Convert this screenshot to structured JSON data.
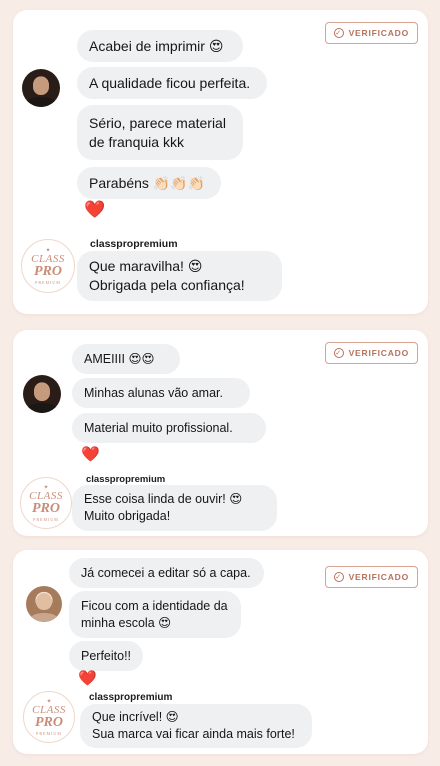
{
  "badge_label": "VERIFICADO",
  "cards": [
    {
      "customer_messages": [
        "Acabei de imprimir 😍",
        "A qualidade ficou perfeita.",
        [
          "Sério, parece material",
          "de franquia kkk"
        ],
        "Parabéns 👏🏻👏🏻👏🏻"
      ],
      "reaction": "❤️",
      "sender": "classpropremium",
      "reply": [
        "Que maravilha! 😍",
        "Obrigada pela confiança!"
      ]
    },
    {
      "customer_messages": [
        "AMEIIII 😍😍",
        "Minhas alunas vão amar.",
        "Material muito profissional."
      ],
      "reaction": "❤️",
      "sender": "classpropremium",
      "reply": [
        "Esse coisa linda de ouvir! 😍",
        "Muito obrigada!"
      ]
    },
    {
      "customer_messages": [
        "Já comecei a editar só a capa.",
        [
          "Ficou com a identidade da",
          "minha escola 😍"
        ],
        "Perfeito!!"
      ],
      "reaction": "❤️",
      "sender": "classpropremium",
      "reply": [
        "Que incrível! 😍",
        "Sua marca vai ficar ainda mais forte!"
      ]
    }
  ],
  "logo": {
    "line1": "CLASS",
    "line2": "PRO",
    "line3": "PREMIUM",
    "star": "✦"
  },
  "colors": {
    "badge": "#b9705a",
    "bubble": "#eff0f2",
    "background": "#f8ece6",
    "heart": "#e23b2e"
  }
}
